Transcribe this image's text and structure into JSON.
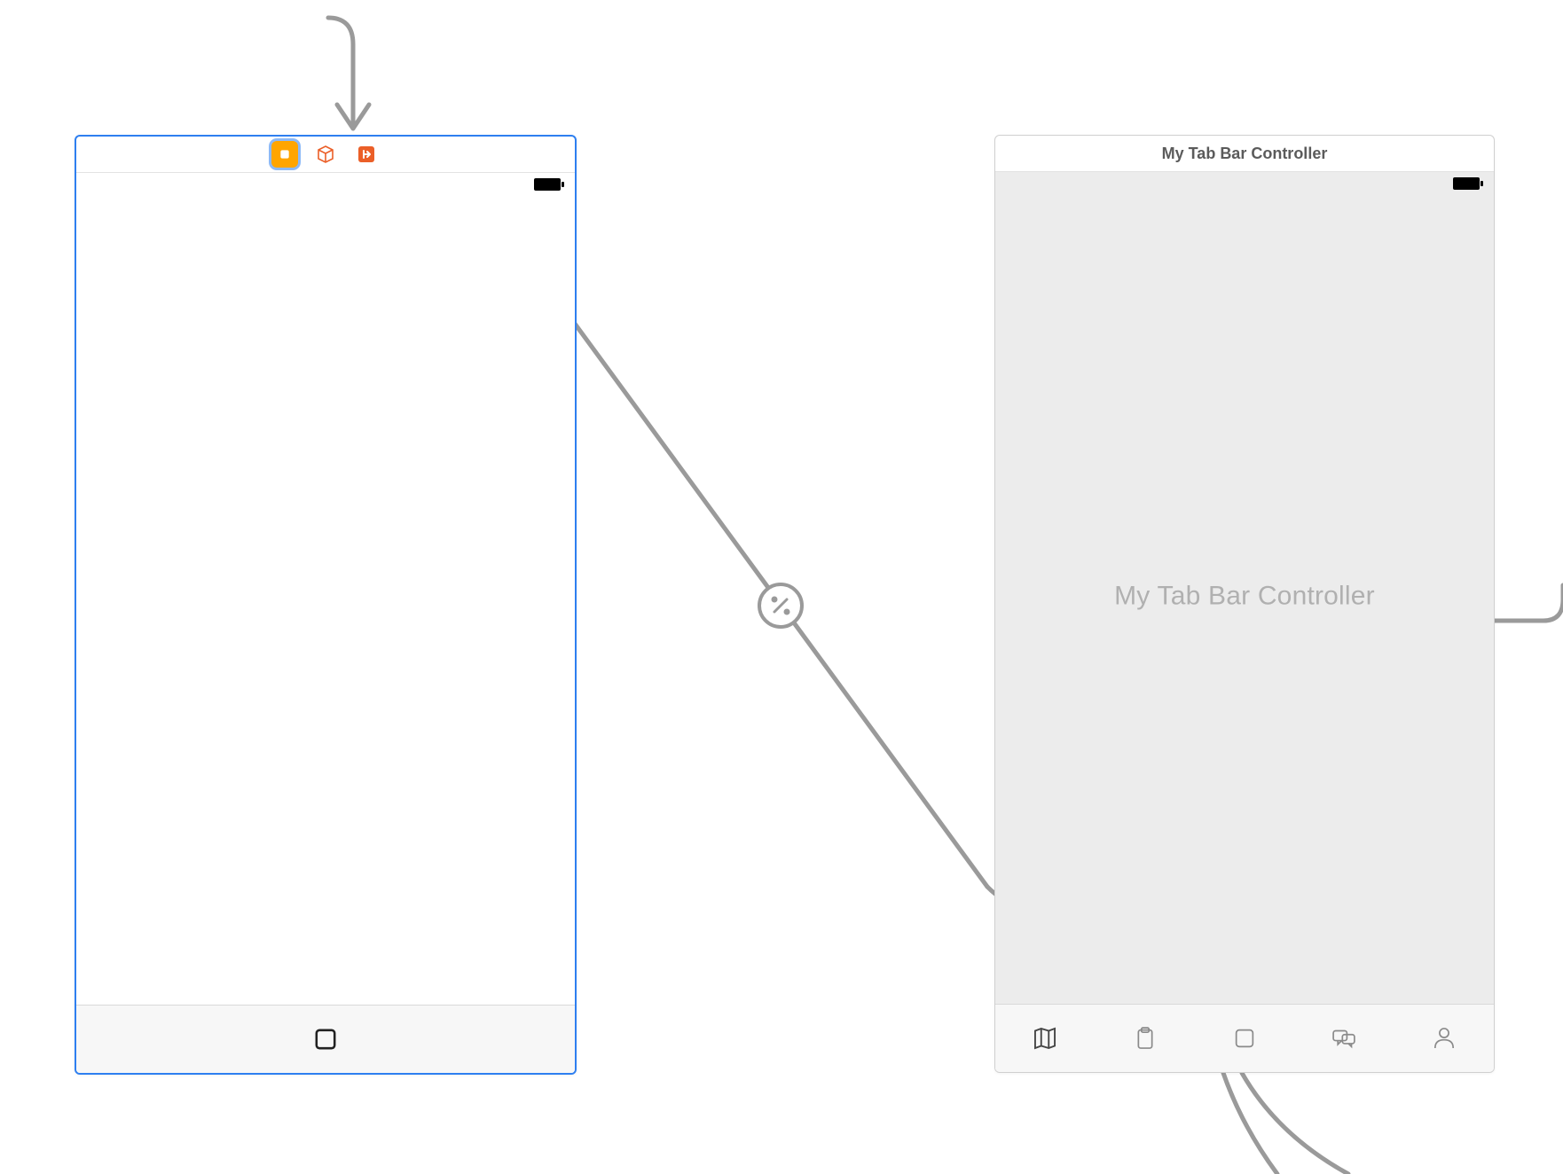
{
  "scene_left": {
    "tab_bar_icon": "square-icon"
  },
  "scene_right": {
    "title": "My Tab Bar Controller",
    "placeholder": "My Tab Bar Controller",
    "tabs": [
      {
        "icon": "map-icon"
      },
      {
        "icon": "clipboard-icon"
      },
      {
        "icon": "square-icon"
      },
      {
        "icon": "chat-icon"
      },
      {
        "icon": "person-icon"
      }
    ]
  }
}
